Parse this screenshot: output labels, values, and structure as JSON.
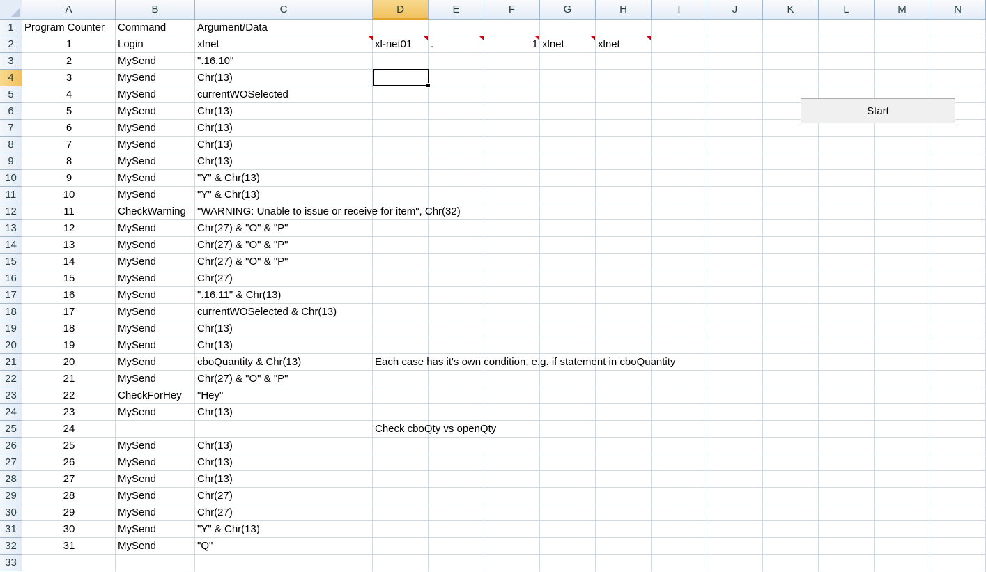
{
  "sheet": {
    "columns": [
      "A",
      "B",
      "C",
      "D",
      "E",
      "F",
      "G",
      "H",
      "I",
      "J",
      "K",
      "L",
      "M",
      "N"
    ],
    "selected_column": "D",
    "selected_row": 4,
    "rows": [
      {
        "n": 1,
        "A": "Program Counter",
        "B": "Command",
        "C": "Argument/Data"
      },
      {
        "n": 2,
        "A": "1",
        "B": "Login",
        "C": "xlnet",
        "D": "xl-net01",
        "E": ".",
        "F": "1",
        "G": "xlnet",
        "H": "xlnet"
      },
      {
        "n": 3,
        "A": "2",
        "B": "MySend",
        "C": "\".16.10\""
      },
      {
        "n": 4,
        "A": "3",
        "B": "MySend",
        "C": "Chr(13)"
      },
      {
        "n": 5,
        "A": "4",
        "B": "MySend",
        "C": "currentWOSelected"
      },
      {
        "n": 6,
        "A": "5",
        "B": "MySend",
        "C": "Chr(13)"
      },
      {
        "n": 7,
        "A": "6",
        "B": "MySend",
        "C": "Chr(13)"
      },
      {
        "n": 8,
        "A": "7",
        "B": "MySend",
        "C": "Chr(13)"
      },
      {
        "n": 9,
        "A": "8",
        "B": "MySend",
        "C": "Chr(13)"
      },
      {
        "n": 10,
        "A": "9",
        "B": "MySend",
        "C": "\"Y\" & Chr(13)"
      },
      {
        "n": 11,
        "A": "10",
        "B": "MySend",
        "C": "\"Y\" & Chr(13)"
      },
      {
        "n": 12,
        "A": "11",
        "B": "CheckWarning",
        "C": "\"WARNING: Unable to issue or receive for item\", Chr(32)"
      },
      {
        "n": 13,
        "A": "12",
        "B": "MySend",
        "C": "Chr(27) & \"O\" & \"P\""
      },
      {
        "n": 14,
        "A": "13",
        "B": "MySend",
        "C": "Chr(27) & \"O\" & \"P\""
      },
      {
        "n": 15,
        "A": "14",
        "B": "MySend",
        "C": "Chr(27) & \"O\" & \"P\""
      },
      {
        "n": 16,
        "A": "15",
        "B": "MySend",
        "C": "Chr(27)"
      },
      {
        "n": 17,
        "A": "16",
        "B": "MySend",
        "C": "\".16.11\" & Chr(13)"
      },
      {
        "n": 18,
        "A": "17",
        "B": "MySend",
        "C": "currentWOSelected & Chr(13)"
      },
      {
        "n": 19,
        "A": "18",
        "B": "MySend",
        "C": "Chr(13)"
      },
      {
        "n": 20,
        "A": "19",
        "B": "MySend",
        "C": "Chr(13)"
      },
      {
        "n": 21,
        "A": "20",
        "B": "MySend",
        "C": "cboQuantity & Chr(13)",
        "D": "Each case has it's own condition, e.g. if statement in cboQuantity"
      },
      {
        "n": 22,
        "A": "21",
        "B": "MySend",
        "C": "Chr(27) & \"O\" & \"P\""
      },
      {
        "n": 23,
        "A": "22",
        "B": "CheckForHey",
        "C": "\"Hey\""
      },
      {
        "n": 24,
        "A": "23",
        "B": "MySend",
        "C": "Chr(13)"
      },
      {
        "n": 25,
        "A": "24",
        "D": "Check cboQty vs openQty"
      },
      {
        "n": 26,
        "A": "25",
        "B": "MySend",
        "C": "Chr(13)"
      },
      {
        "n": 27,
        "A": "26",
        "B": "MySend",
        "C": "Chr(13)"
      },
      {
        "n": 28,
        "A": "27",
        "B": "MySend",
        "C": "Chr(13)"
      },
      {
        "n": 29,
        "A": "28",
        "B": "MySend",
        "C": "Chr(27)"
      },
      {
        "n": 30,
        "A": "29",
        "B": "MySend",
        "C": "Chr(27)"
      },
      {
        "n": 31,
        "A": "30",
        "B": "MySend",
        "C": "\"Y\" & Chr(13)"
      },
      {
        "n": 32,
        "A": "31",
        "B": "MySend",
        "C": "\"Q\""
      },
      {
        "n": 33
      }
    ]
  },
  "start_button": {
    "label": "Start"
  },
  "colors": {
    "grid": "#d0d7e5",
    "header_bg": "#e4ecf7",
    "selected_header": "#f1c15f",
    "comment_marker": "#e00000"
  }
}
